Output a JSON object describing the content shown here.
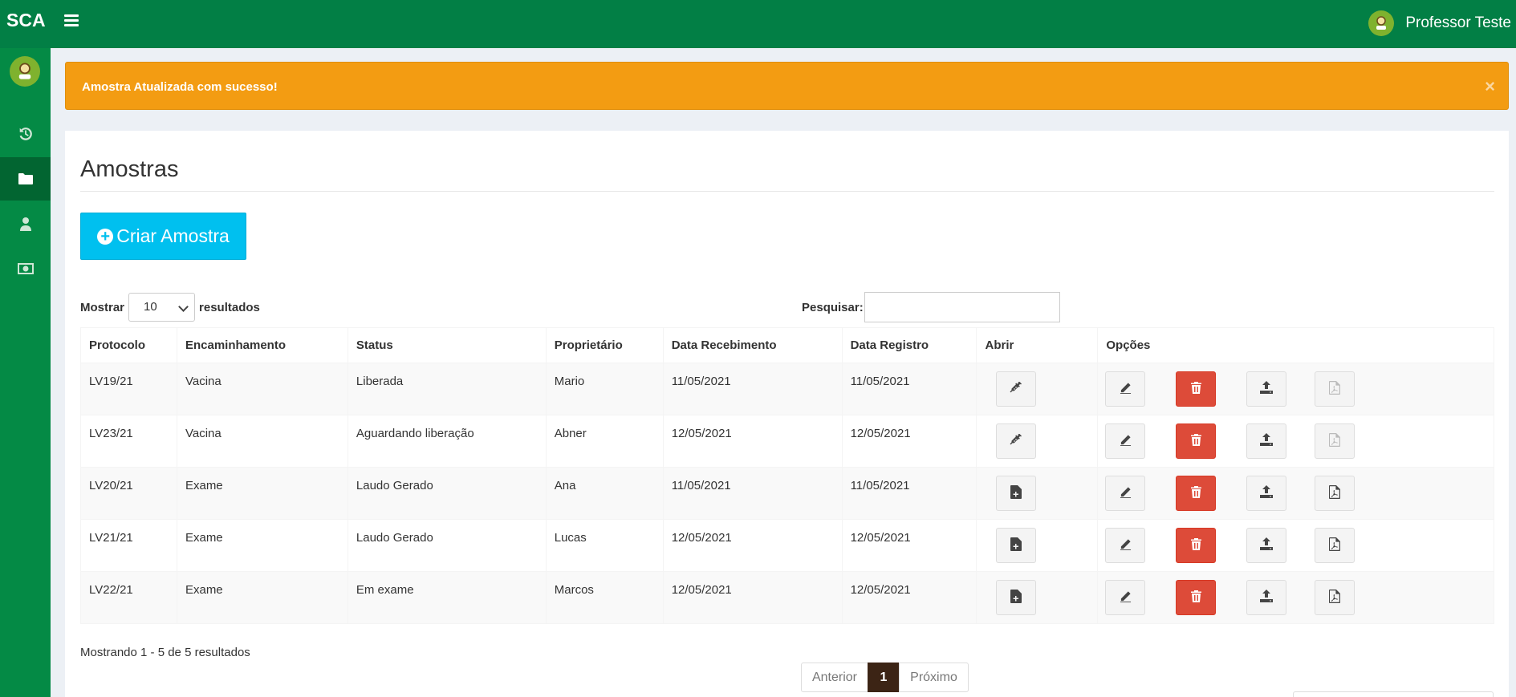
{
  "topbar": {
    "brand": "SCA",
    "user_name": "Professor Teste",
    "menu_icon": "hamburger-icon",
    "avatar_icon": "user-avatar-icon"
  },
  "sidebar": {
    "items": [
      {
        "icon": "history-icon",
        "active": false
      },
      {
        "icon": "folder-icon",
        "active": true
      },
      {
        "icon": "user-icon",
        "active": false
      },
      {
        "icon": "money-icon",
        "active": false
      }
    ]
  },
  "alert": {
    "message": "Amostra Atualizada com sucesso!",
    "close": "×",
    "color": "#f39c12"
  },
  "page": {
    "title": "Amostras",
    "create_button": "Criar Amostra"
  },
  "table_controls": {
    "show_label": "Mostrar",
    "show_value": "10",
    "results_label": "resultados",
    "search_label": "Pesquisar:",
    "search_value": ""
  },
  "table": {
    "headers": [
      "Protocolo",
      "Encaminhamento",
      "Status",
      "Proprietário",
      "Data Recebimento",
      "Data Registro",
      "Abrir",
      "Opções"
    ],
    "rows": [
      {
        "protocolo": "LV19/21",
        "encaminhamento": "Vacina",
        "status": "Liberada",
        "proprietario": "Mario",
        "data_recebimento": "11/05/2021",
        "data_registro": "11/05/2021",
        "open_icon": "syringe-icon",
        "pdf_enabled": false
      },
      {
        "protocolo": "LV23/21",
        "encaminhamento": "Vacina",
        "status": "Aguardando liberação",
        "proprietario": "Abner",
        "data_recebimento": "12/05/2021",
        "data_registro": "12/05/2021",
        "open_icon": "syringe-icon",
        "pdf_enabled": false
      },
      {
        "protocolo": "LV20/21",
        "encaminhamento": "Exame",
        "status": "Laudo Gerado",
        "proprietario": "Ana",
        "data_recebimento": "11/05/2021",
        "data_registro": "11/05/2021",
        "open_icon": "file-add-icon",
        "pdf_enabled": true
      },
      {
        "protocolo": "LV21/21",
        "encaminhamento": "Exame",
        "status": "Laudo Gerado",
        "proprietario": "Lucas",
        "data_recebimento": "12/05/2021",
        "data_registro": "12/05/2021",
        "open_icon": "file-add-icon",
        "pdf_enabled": true
      },
      {
        "protocolo": "LV22/21",
        "encaminhamento": "Exame",
        "status": "Em exame",
        "proprietario": "Marcos",
        "data_recebimento": "12/05/2021",
        "data_registro": "12/05/2021",
        "open_icon": "file-add-icon",
        "pdf_enabled": true
      }
    ]
  },
  "footer": {
    "info": "Mostrando 1 - 5 de 5 resultados",
    "prev": "Anterior",
    "current": "1",
    "next": "Próximo"
  }
}
